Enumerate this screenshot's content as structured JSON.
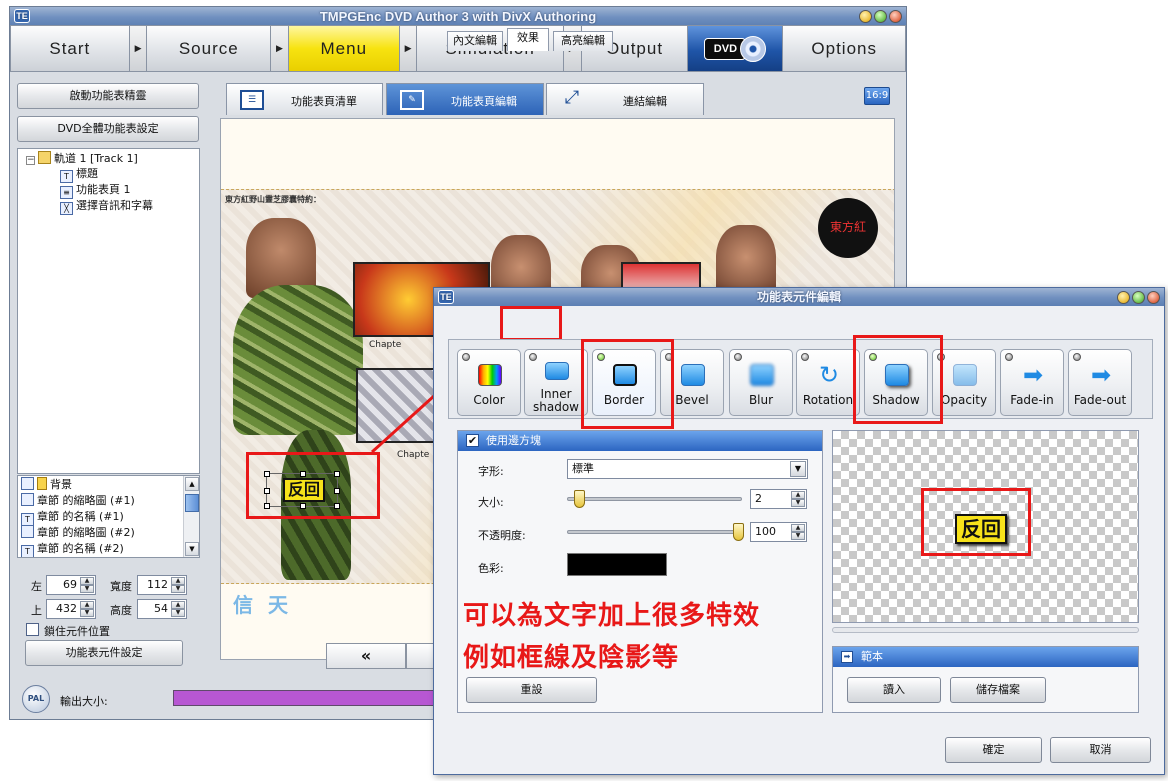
{
  "app": {
    "title": "TMPGEnc DVD Author 3 with DivX Authoring",
    "icon_text": "TE"
  },
  "nav": {
    "start": "Start",
    "source": "Source",
    "menu": "Menu",
    "simulation": "Simulation",
    "output": "Output",
    "dvd": "DVD",
    "options": "Options",
    "active_color": "#f2de00"
  },
  "left_panel": {
    "wizard_button": "啟動功能表精靈",
    "dvd_menu_button": "DVD全體功能表設定",
    "tree": {
      "root": "軌道 1 [Track 1]",
      "children": [
        "標題",
        "功能表頁 1",
        "選擇音訊和字幕"
      ]
    },
    "layers": [
      "背景",
      "章節 的縮略圖 (#1)",
      "章節 的名稱 (#1)",
      "章節 的縮略圖 (#2)",
      "章節 的名稱 (#2)"
    ],
    "coords": {
      "left_label": "左",
      "left_value": "69",
      "width_label": "寬度",
      "width_value": "112",
      "top_label": "上",
      "top_value": "432",
      "height_label": "高度",
      "height_value": "54",
      "lock_label": "鎖住元件位置"
    },
    "element_settings_button": "功能表元件設定"
  },
  "main_tabs": [
    "功能表頁清單",
    "功能表頁編輯",
    "連結編輯"
  ],
  "aspect_badge": "16:9",
  "canvas": {
    "top_text": "東方紅野山靈芝膠囊特約：",
    "chapter_label_1": "Chapte",
    "chapter_label_2": "Chapte",
    "logo_text": "東方紅",
    "back_button_text": "反回",
    "credits_text": "信 天",
    "prev_button": "«"
  },
  "status": {
    "pal": "PAL",
    "output_size_label": "輸出大小:",
    "bar_color": "#b757d3"
  },
  "dialog": {
    "title": "功能表元件編輯",
    "tabs": [
      "內文編輯",
      "效果",
      "高亮編輯"
    ],
    "effects": [
      {
        "label": "Color",
        "icon": "color-palette-icon"
      },
      {
        "label": "Inner shadow",
        "icon": "inner-shadow-icon"
      },
      {
        "label": "Border",
        "icon": "border-icon"
      },
      {
        "label": "Bevel",
        "icon": "bevel-icon"
      },
      {
        "label": "Blur",
        "icon": "blur-icon"
      },
      {
        "label": "Rotation",
        "icon": "rotation-icon"
      },
      {
        "label": "Shadow",
        "icon": "shadow-icon"
      },
      {
        "label": "Opacity",
        "icon": "opacity-icon"
      },
      {
        "label": "Fade-in",
        "icon": "fade-in-arrow-icon"
      },
      {
        "label": "Fade-out",
        "icon": "fade-out-arrow-icon"
      }
    ],
    "border_group": {
      "title": "使用邊方塊",
      "shape_label": "字形:",
      "shape_value": "標準",
      "size_label": "大小:",
      "size_value": "2",
      "opacity_label": "不透明度:",
      "opacity_value": "100",
      "color_label": "色彩:",
      "color_value": "#000000",
      "reset_button": "重設"
    },
    "preview_text": "反回",
    "template_group": {
      "title": "範本",
      "load_button": "讀入",
      "save_button": "儲存檔案"
    },
    "ok_button": "確定",
    "cancel_button": "取消"
  },
  "annotation": {
    "line1": "可以為文字加上很多特效",
    "line2": "例如框線及陰影等",
    "color": "#e81818"
  }
}
